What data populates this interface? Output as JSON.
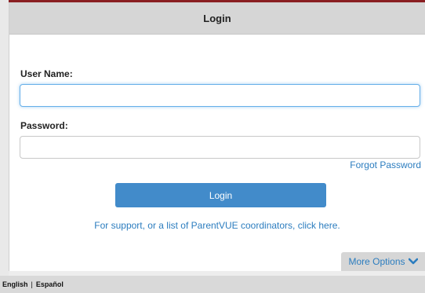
{
  "header": {
    "title": "Login"
  },
  "form": {
    "username_label": "User Name:",
    "username_value": "",
    "password_label": "Password:",
    "password_value": "",
    "forgot_password": "Forgot Password",
    "login_button": "Login"
  },
  "support_link": "For support, or a list of ParentVUE coordinators, click here.",
  "more_options": {
    "label": "More Options",
    "icon": "chevron-down-icon"
  },
  "footer": {
    "languages": [
      "English",
      "Español"
    ],
    "separator": "|"
  },
  "colors": {
    "accent": "#428bca",
    "link": "#2c7dbf",
    "top_border": "#8a1f22"
  }
}
